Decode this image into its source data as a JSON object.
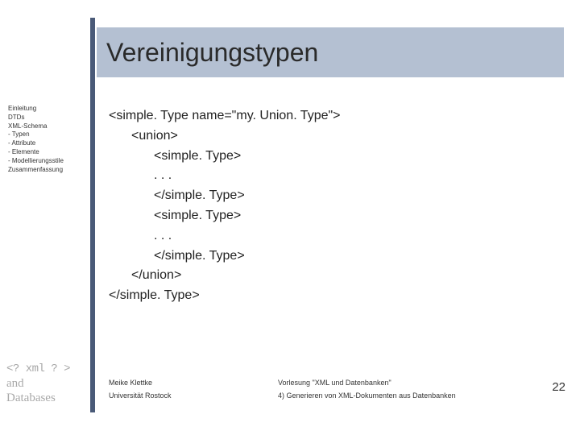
{
  "title": "Vereinigungstypen",
  "sidebar": {
    "items": [
      "Einleitung",
      "DTDs",
      "XML-Schema",
      "- Typen",
      "- Attribute",
      "- Elemente",
      "- Modellierungsstile",
      "Zusammenfassung"
    ]
  },
  "code": {
    "l0": "<simple. Type name=\"my. Union. Type\">",
    "l1": "<union>",
    "l2": "<simple. Type>",
    "l3": ". . .",
    "l4": "</simple. Type>",
    "l5": "<simple. Type>",
    "l6": ". . .",
    "l7": "</simple. Type>",
    "l8": "</union>",
    "l9": "</simple. Type>"
  },
  "logo": {
    "row1": "<? xml ? >",
    "row2": "and",
    "row3": "Databases"
  },
  "footer": {
    "author": "Meike Klettke",
    "lecture": "Vorlesung \"XML und Datenbanken\"",
    "institution": "Universität Rostock",
    "topic": "4) Generieren von XML-Dokumenten aus Datenbanken"
  },
  "page_number": "22"
}
